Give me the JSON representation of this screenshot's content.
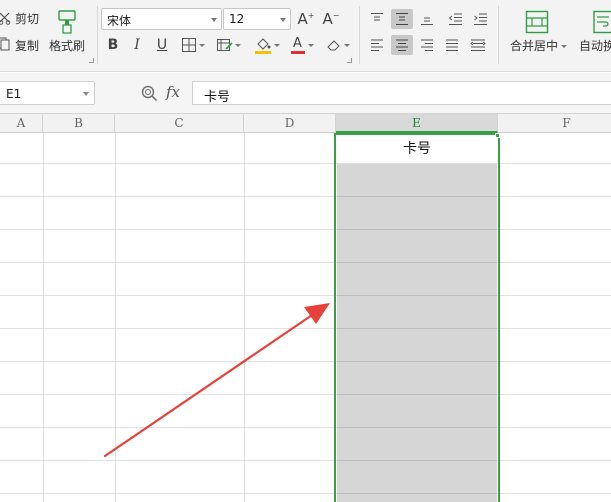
{
  "ribbon": {
    "clipboard": {
      "cut": "剪切",
      "copy": "复制",
      "format_painter": "格式刷"
    },
    "font": {
      "name": "宋体",
      "size": "12"
    },
    "alignment": {
      "merge_center": "合并居中",
      "wrap_text": "自动换"
    }
  },
  "formula_bar": {
    "name_box": "E1",
    "fx": "fx",
    "content": "卡号"
  },
  "sheet": {
    "columns": [
      "A",
      "B",
      "C",
      "D",
      "E",
      "F"
    ],
    "selected_column": "E",
    "cells": {
      "E1": "卡号"
    }
  },
  "colors": {
    "selection_border": "#3a9e4c",
    "annotation_arrow": "#e8413a",
    "font_color_underline": "#e03030",
    "fill_color_underline": "#f5c400"
  }
}
